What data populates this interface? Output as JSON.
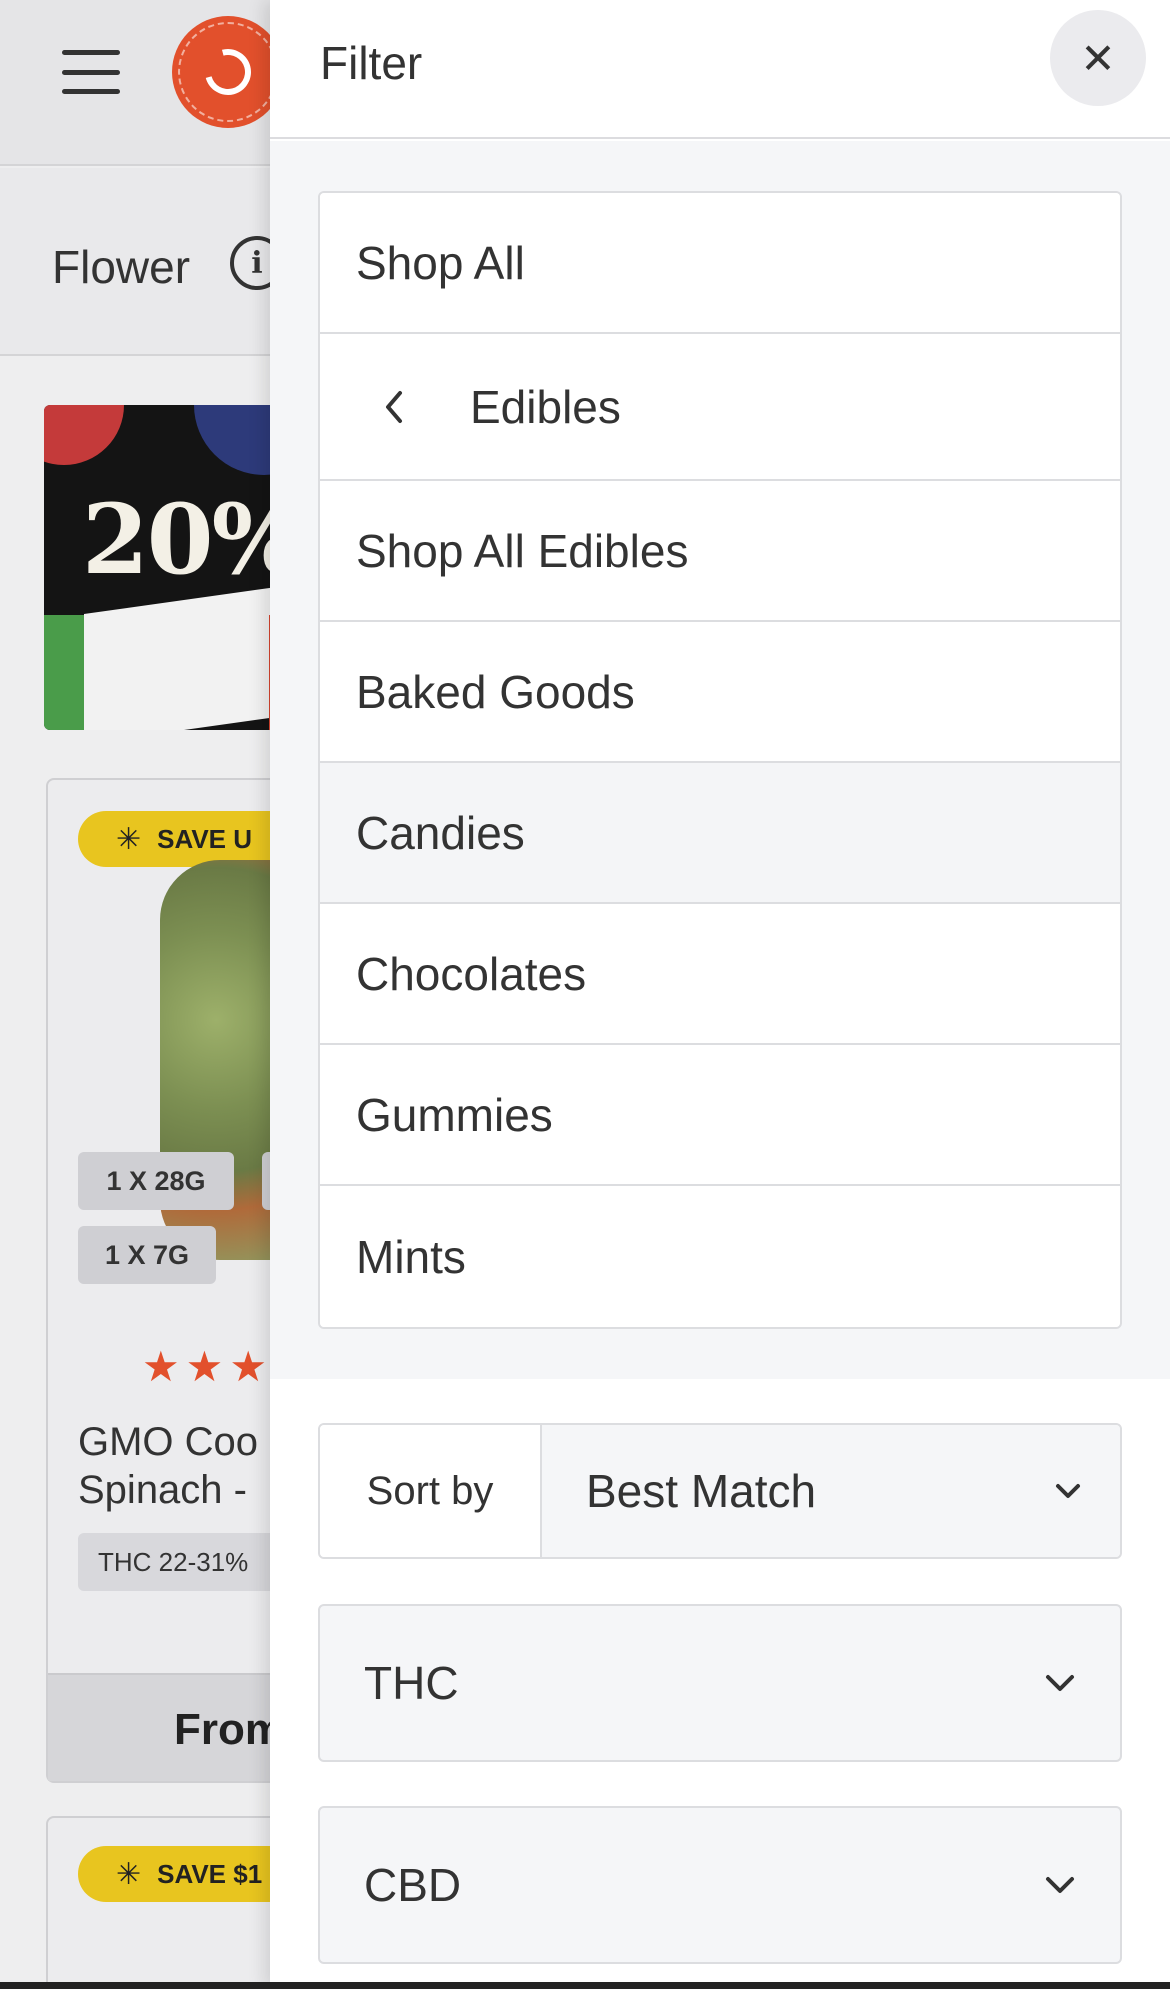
{
  "background": {
    "category_title": "Flower",
    "promo": {
      "headline": "20%"
    },
    "product_card": {
      "badge": "SAVE U",
      "sizes": [
        "1 X 28G",
        "1 X 7G"
      ],
      "rating_stars": 3,
      "name_lines": [
        "GMO Coo",
        "Spinach -"
      ],
      "thc": "THC 22-31%",
      "price_prefix": "From"
    },
    "product_card_2": {
      "badge": "SAVE $1"
    }
  },
  "drawer": {
    "title": "Filter",
    "close_icon": "close-icon",
    "categories": {
      "shop_all": "Shop All",
      "back_label": "Edibles",
      "items": [
        "Shop All Edibles",
        "Baked Goods",
        "Candies",
        "Chocolates",
        "Gummies",
        "Mints"
      ],
      "highlighted": "Candies"
    },
    "sort": {
      "label": "Sort by",
      "value": "Best Match"
    },
    "accordions": [
      {
        "label": "THC"
      },
      {
        "label": "CBD"
      }
    ]
  },
  "colors": {
    "brand_orange": "#e2502c",
    "badge_yellow": "#e8c51f",
    "panel_bg": "#f5f6f8"
  }
}
